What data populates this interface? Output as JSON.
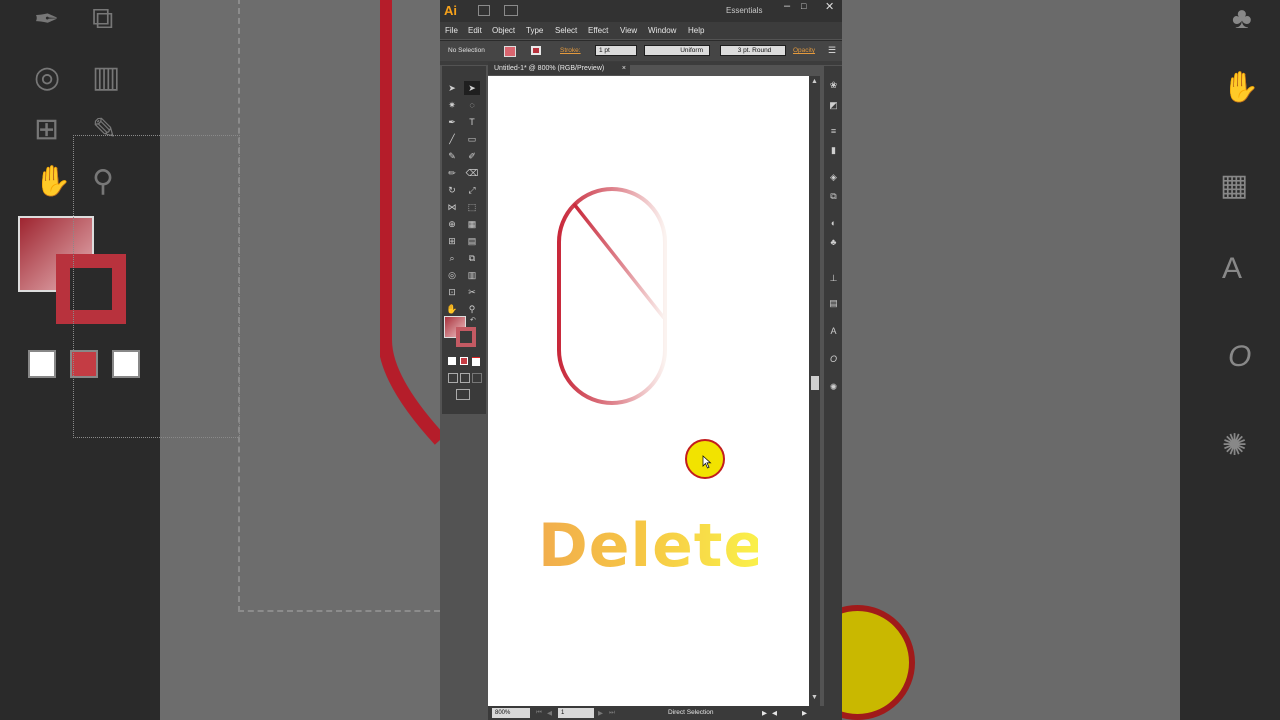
{
  "app": {
    "logo": "Ai",
    "workspace": "Essentials",
    "window_controls": [
      "minimize-icon",
      "maximize-icon",
      "close-icon"
    ]
  },
  "menu": {
    "items": [
      "File",
      "Edit",
      "Object",
      "Type",
      "Select",
      "Effect",
      "View",
      "Window",
      "Help"
    ]
  },
  "control_bar": {
    "selection_label": "No Selection",
    "stroke_label": "Stroke:",
    "stroke_weight": "1 pt",
    "profile": "Uniform",
    "brush": "3 pt. Round",
    "opacity_label": "Opacity"
  },
  "document": {
    "tab_label": "Untitled-1* @ 800% (RGB/Preview)",
    "close_glyph": "×"
  },
  "status": {
    "zoom": "800%",
    "artboard_number": "1",
    "tool_name": "Direct Selection"
  },
  "caption": {
    "text": "Delete",
    "gradient_start": "#f1ad4d",
    "gradient_end": "#faf04a"
  },
  "colors": {
    "accent_orange": "#f7a21b",
    "stroke_red": "#c8283a",
    "cursor_yellow": "#f2e300",
    "cursor_ring": "#c21d1d"
  },
  "toolbox": {
    "tools": [
      "selection-tool-icon",
      "direct-selection-tool-icon",
      "magic-wand-icon",
      "lasso-icon",
      "pen-tool-icon",
      "type-tool-icon",
      "line-tool-icon",
      "rectangle-tool-icon",
      "paintbrush-icon",
      "pencil-icon",
      "blob-brush-icon",
      "eraser-icon",
      "rotate-icon",
      "scale-icon",
      "width-tool-icon",
      "free-transform-icon",
      "shape-builder-icon",
      "perspective-grid-icon",
      "mesh-tool-icon",
      "gradient-tool-icon",
      "eyedropper-icon",
      "blend-tool-icon",
      "symbol-sprayer-icon",
      "graph-tool-icon",
      "artboard-tool-icon",
      "slice-tool-icon",
      "hand-tool-icon",
      "zoom-tool-icon"
    ]
  }
}
